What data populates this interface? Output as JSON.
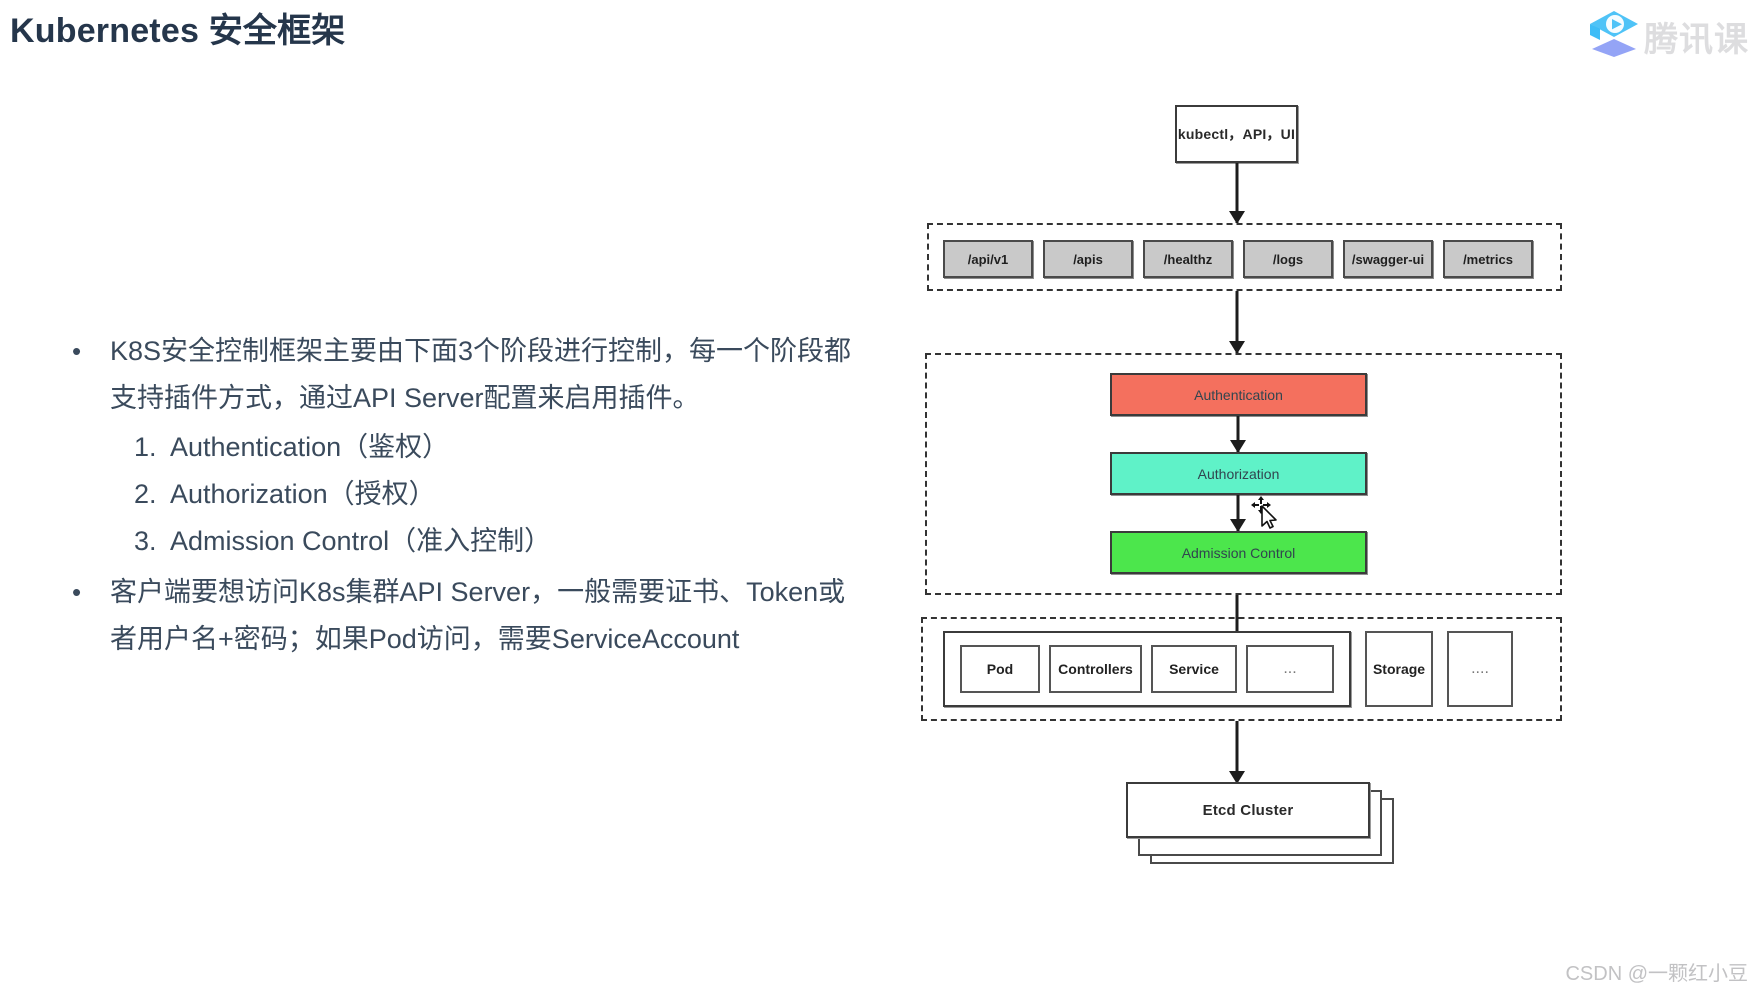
{
  "slide": {
    "title": "Kubernetes 安全框架",
    "title_color": "#25364b",
    "background": "#ffffff"
  },
  "logo": {
    "name": "tencent-classroom-logo",
    "text": "腾讯课",
    "cap_color": "#4fc3f7",
    "base_color": "#8b9cf5"
  },
  "body": {
    "bullet1": {
      "marker": "•",
      "line1": "K8S安全控制框架主要由下面3个阶段进行控制，每一个阶段都",
      "line2": "支持插件方式，通过API Server配置来启用插件。"
    },
    "numbered": [
      {
        "num": "1.",
        "label": "Authentication（鉴权）"
      },
      {
        "num": "2.",
        "label": "Authorization（授权）"
      },
      {
        "num": "3.",
        "label": "Admission Control（准入控制）"
      }
    ],
    "bullet2": {
      "marker": "•",
      "line1": "客户端要想访问K8s集群API Server，一般需要证书、Token或",
      "line2": "者用户名+密码；如果Pod访问，需要ServiceAccount"
    }
  },
  "diagram": {
    "client_box": "kubectl，API，UI",
    "api_paths": [
      "/api/v1",
      "/apis",
      "/healthz",
      "/logs",
      "/swagger-ui",
      "/metrics"
    ],
    "stages": [
      {
        "label": "Authentication",
        "color": "#f4705e"
      },
      {
        "label": "Authorization",
        "color": "#5ff2c8"
      },
      {
        "label": "Admission Control",
        "color": "#4ce64c"
      }
    ],
    "resources_inner": [
      "Pod",
      "Controllers",
      "Service",
      "..."
    ],
    "resources_outer": [
      "Storage",
      "...."
    ],
    "etcd": "Etcd Cluster"
  },
  "watermark": {
    "csdn": "CSDN @一颗红小豆"
  }
}
